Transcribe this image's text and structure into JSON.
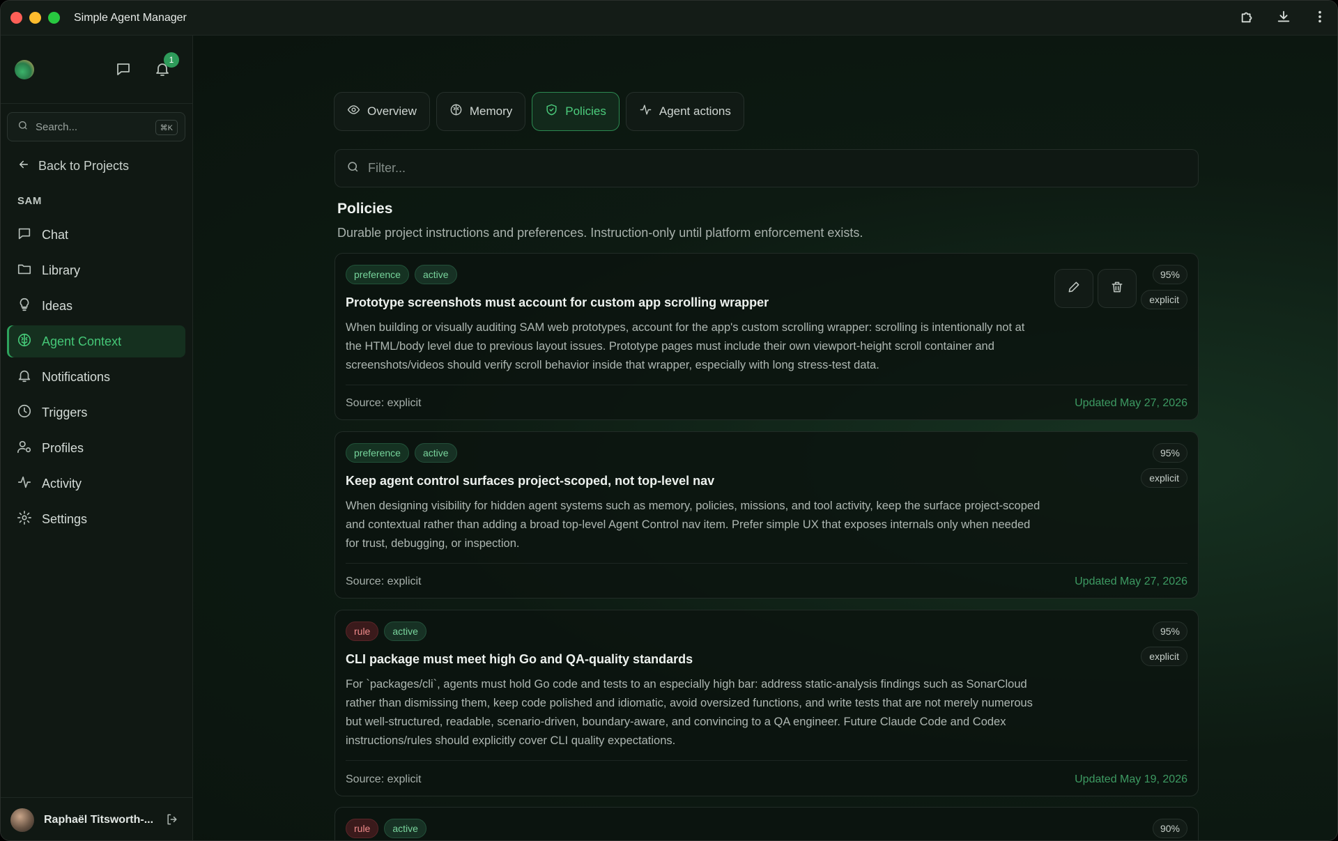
{
  "window": {
    "title": "Simple Agent Manager"
  },
  "sidebar": {
    "notification_count": "1",
    "search_placeholder": "Search...",
    "search_shortcut": "⌘K",
    "back_label": "Back to Projects",
    "section_label": "SAM",
    "items": [
      {
        "label": "Chat",
        "icon": "chat-icon"
      },
      {
        "label": "Library",
        "icon": "folder-icon"
      },
      {
        "label": "Ideas",
        "icon": "lightbulb-icon"
      },
      {
        "label": "Agent Context",
        "icon": "brain-icon",
        "active": true
      },
      {
        "label": "Notifications",
        "icon": "bell-icon"
      },
      {
        "label": "Triggers",
        "icon": "clock-icon"
      },
      {
        "label": "Profiles",
        "icon": "user-gear-icon"
      },
      {
        "label": "Activity",
        "icon": "activity-icon"
      },
      {
        "label": "Settings",
        "icon": "gear-icon"
      }
    ],
    "user_name": "Raphaël Titsworth-..."
  },
  "tabs": [
    {
      "label": "Overview",
      "icon": "eye-icon"
    },
    {
      "label": "Memory",
      "icon": "brain-icon"
    },
    {
      "label": "Policies",
      "icon": "shield-check-icon",
      "active": true
    },
    {
      "label": "Agent actions",
      "icon": "activity-icon"
    }
  ],
  "filter_placeholder": "Filter...",
  "policies": {
    "title": "Policies",
    "subtitle": "Durable project instructions and preferences. Instruction-only until platform enforcement exists.",
    "cards": [
      {
        "kind": "preference",
        "status": "active",
        "confidence": "95%",
        "source_badge": "explicit",
        "title": "Prototype screenshots must account for custom app scrolling wrapper",
        "body": "When building or visually auditing SAM web prototypes, account for the app's custom scrolling wrapper: scrolling is intentionally not at the HTML/body level due to previous layout issues. Prototype pages must include their own viewport-height scroll container and screenshots/videos should verify scroll behavior inside that wrapper, especially with long stress-test data.",
        "source": "Source: explicit",
        "updated": "Updated May 27, 2026"
      },
      {
        "kind": "preference",
        "status": "active",
        "confidence": "95%",
        "source_badge": "explicit",
        "title": "Keep agent control surfaces project-scoped, not top-level nav",
        "body": "When designing visibility for hidden agent systems such as memory, policies, missions, and tool activity, keep the surface project-scoped and contextual rather than adding a broad top-level Agent Control nav item. Prefer simple UX that exposes internals only when needed for trust, debugging, or inspection.",
        "source": "Source: explicit",
        "updated": "Updated May 27, 2026"
      },
      {
        "kind": "rule",
        "status": "active",
        "confidence": "95%",
        "source_badge": "explicit",
        "title": "CLI package must meet high Go and QA-quality standards",
        "body": "For `packages/cli`, agents must hold Go code and tests to an especially high bar: address static-analysis findings such as SonarCloud rather than dismissing them, keep code polished and idiomatic, avoid oversized functions, and write tests that are not merely numerous but well-structured, readable, scenario-driven, boundary-aware, and convincing to a QA engineer. Future Claude Code and Codex instructions/rules should explicitly cover CLI quality expectations.",
        "source": "Source: explicit",
        "updated": "Updated May 19, 2026"
      },
      {
        "kind": "rule",
        "status": "active",
        "confidence": "90%"
      }
    ]
  }
}
